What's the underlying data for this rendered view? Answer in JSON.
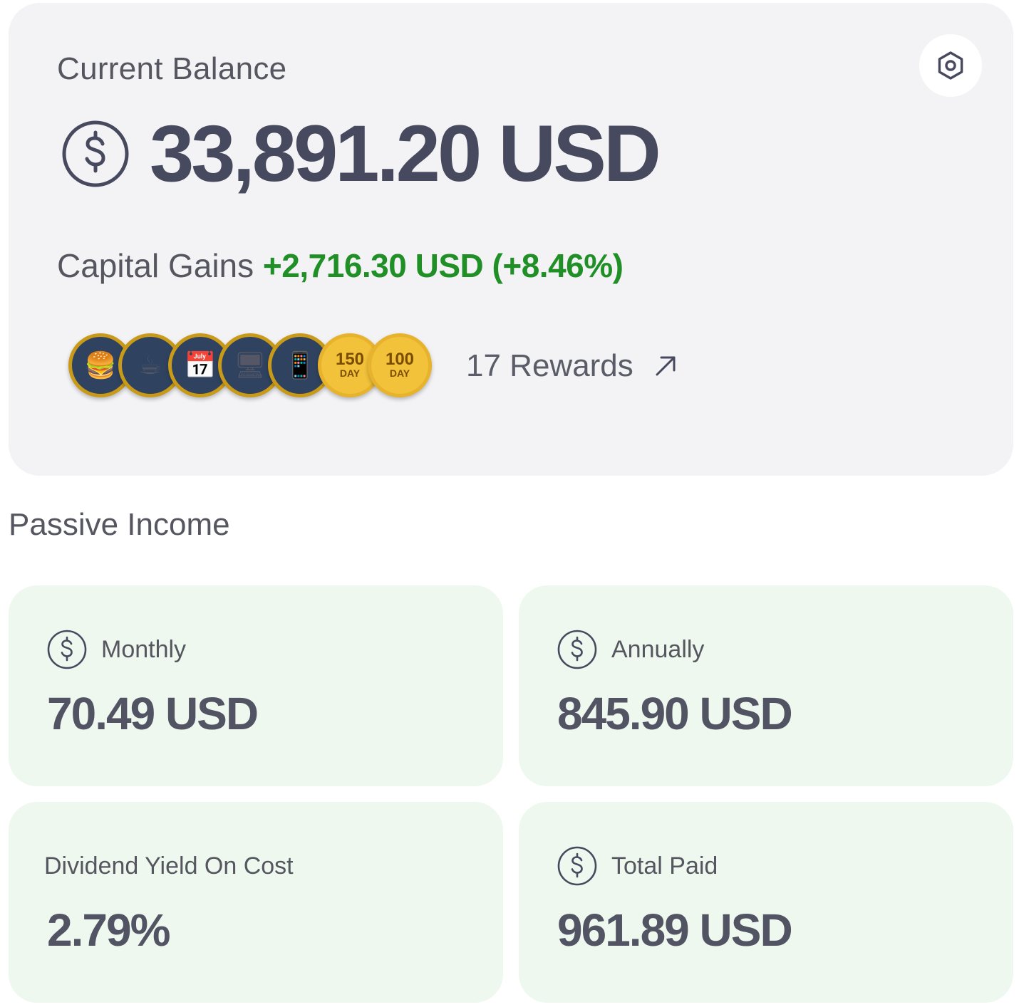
{
  "balance": {
    "label": "Current Balance",
    "value": "33,891.20 USD",
    "gains_label": "Capital Gains",
    "gains_value": "+2,716.30 USD (+8.46%)",
    "settings_icon": "settings-hexagon-icon",
    "currency_icon": "dollar-circle-icon"
  },
  "rewards": {
    "badges": [
      {
        "icon": "burger-icon",
        "glyph": "🍔"
      },
      {
        "icon": "coffee-icon",
        "glyph": "☕"
      },
      {
        "icon": "calendar-coin-icon",
        "glyph": "📅"
      },
      {
        "icon": "computer-globe-icon",
        "glyph": "🖥"
      },
      {
        "icon": "phone-notification-icon",
        "glyph": "📱"
      },
      {
        "icon": "streak-badge",
        "num": "150",
        "unit": "DAY"
      },
      {
        "icon": "streak-badge",
        "num": "100",
        "unit": "DAY"
      }
    ],
    "link_label": "17 Rewards",
    "link_icon": "arrow-up-right-icon"
  },
  "passive_income": {
    "title": "Passive Income",
    "monthly_label": "Monthly",
    "monthly_value": "70.49 USD",
    "annually_label": "Annually",
    "annually_value": "845.90 USD",
    "yield_label": "Dividend Yield On Cost",
    "yield_value": "2.79%",
    "total_label": "Total Paid",
    "total_value": "961.89 USD"
  },
  "colors": {
    "card_bg": "#f3f3f5",
    "stat_bg": "#eef8ee",
    "positive": "#1f8f26",
    "text": "#474a5e",
    "badge_gold": "#f2c23a"
  }
}
